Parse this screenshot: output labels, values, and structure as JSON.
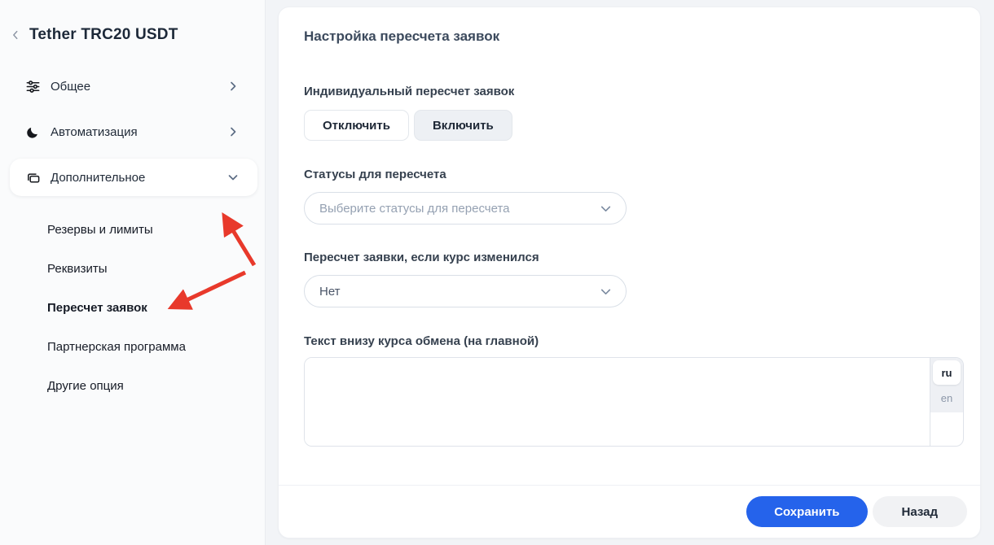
{
  "sidebar": {
    "title": "Tether TRC20 USDT",
    "items": [
      {
        "label": "Общее",
        "icon": "sliders-icon"
      },
      {
        "label": "Автоматизация",
        "icon": "moon-icon"
      },
      {
        "label": "Дополнительное",
        "icon": "folders-icon",
        "expanded": true
      }
    ],
    "subitems": [
      {
        "label": "Резервы и лимиты"
      },
      {
        "label": "Реквизиты"
      },
      {
        "label": "Пересчет заявок",
        "active": true
      },
      {
        "label": "Партнерская программа"
      },
      {
        "label": "Другие опция"
      }
    ]
  },
  "main": {
    "title": "Настройка пересчета заявок",
    "individual_recalc": {
      "label": "Индивидуальный пересчет заявок",
      "off_label": "Отключить",
      "on_label": "Включить",
      "selected": "Включить"
    },
    "statuses": {
      "label": "Статусы для пересчета",
      "placeholder": "Выберите статусы для пересчета"
    },
    "rate_changed": {
      "label": "Пересчет заявки, если курс изменился",
      "value": "Нет"
    },
    "bottom_text": {
      "label": "Текст внизу курса обмена (на главной)",
      "value": "",
      "lang_tabs": {
        "ru": "ru",
        "en": "en"
      },
      "active_lang": "ru"
    },
    "footer": {
      "save_label": "Сохранить",
      "back_label": "Назад"
    }
  },
  "colors": {
    "accent_blue": "#2563eb",
    "arrow_red": "#e8392b",
    "sidebar_bg": "#fafbfc",
    "page_bg": "#f2f4f7"
  }
}
